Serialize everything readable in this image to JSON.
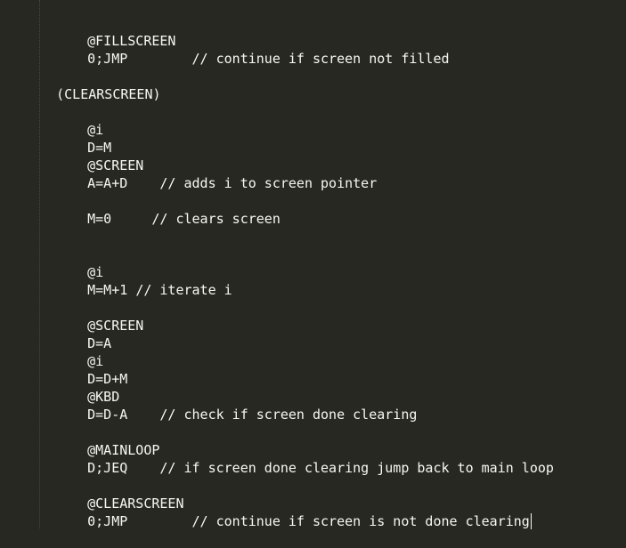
{
  "editor": {
    "lines": [
      {
        "code": "@FILLSCREEN",
        "comment": ""
      },
      {
        "code": "0;JMP        ",
        "comment": "// continue if screen not filled"
      },
      {
        "code": "(CLEARSCREEN)",
        "comment": ""
      },
      {
        "code": "@i",
        "comment": ""
      },
      {
        "code": "D=M",
        "comment": ""
      },
      {
        "code": "@SCREEN",
        "comment": ""
      },
      {
        "code": "A=A+D    ",
        "comment": "// adds i to screen pointer"
      },
      {
        "code": "M=0     ",
        "comment": "// clears screen"
      },
      {
        "code": "@i",
        "comment": ""
      },
      {
        "code": "M=M+1 ",
        "comment": "// iterate i"
      },
      {
        "code": "@SCREEN",
        "comment": ""
      },
      {
        "code": "D=A",
        "comment": ""
      },
      {
        "code": "@i",
        "comment": ""
      },
      {
        "code": "D=D+M",
        "comment": ""
      },
      {
        "code": "@KBD",
        "comment": ""
      },
      {
        "code": "D=D-A    ",
        "comment": "// check if screen done clearing"
      },
      {
        "code": "@MAINLOOP",
        "comment": ""
      },
      {
        "code": "D;JEQ    ",
        "comment": "// if screen done clearing jump back to main loop"
      },
      {
        "code": "@CLEARSCREEN",
        "comment": ""
      },
      {
        "code": "0;JMP        ",
        "comment": "// continue if screen is not done clearing"
      }
    ]
  },
  "colors": {
    "background": "#272822",
    "text": "#f8f8f2"
  }
}
